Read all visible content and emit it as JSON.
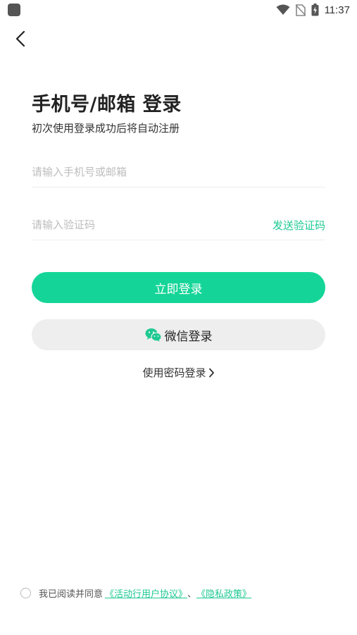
{
  "status_bar": {
    "time": "11:37",
    "icons": [
      "app-notification-icon",
      "wifi-icon",
      "no-sim-icon",
      "battery-charging-icon"
    ]
  },
  "nav": {
    "back_icon": "back-arrow-icon"
  },
  "header": {
    "title": "手机号/邮箱 登录",
    "subtitle": "初次使用登录成功后将自动注册"
  },
  "form": {
    "phone_placeholder": "请输入手机号或邮箱",
    "phone_value": "",
    "code_placeholder": "请输入验证码",
    "code_value": "",
    "send_code_label": "发送验证码"
  },
  "actions": {
    "login_label": "立即登录",
    "wechat_label": "微信登录",
    "wechat_icon": "wechat-icon",
    "password_login_label": "使用密码登录"
  },
  "agreement": {
    "prefix": "我已阅读并同意",
    "terms_link": "《活动行用户协议》",
    "separator": "、",
    "privacy_link": "《隐私政策》"
  },
  "colors": {
    "accent": "#14d597",
    "link": "#1ec992",
    "secondary_button": "#eeeeee"
  }
}
